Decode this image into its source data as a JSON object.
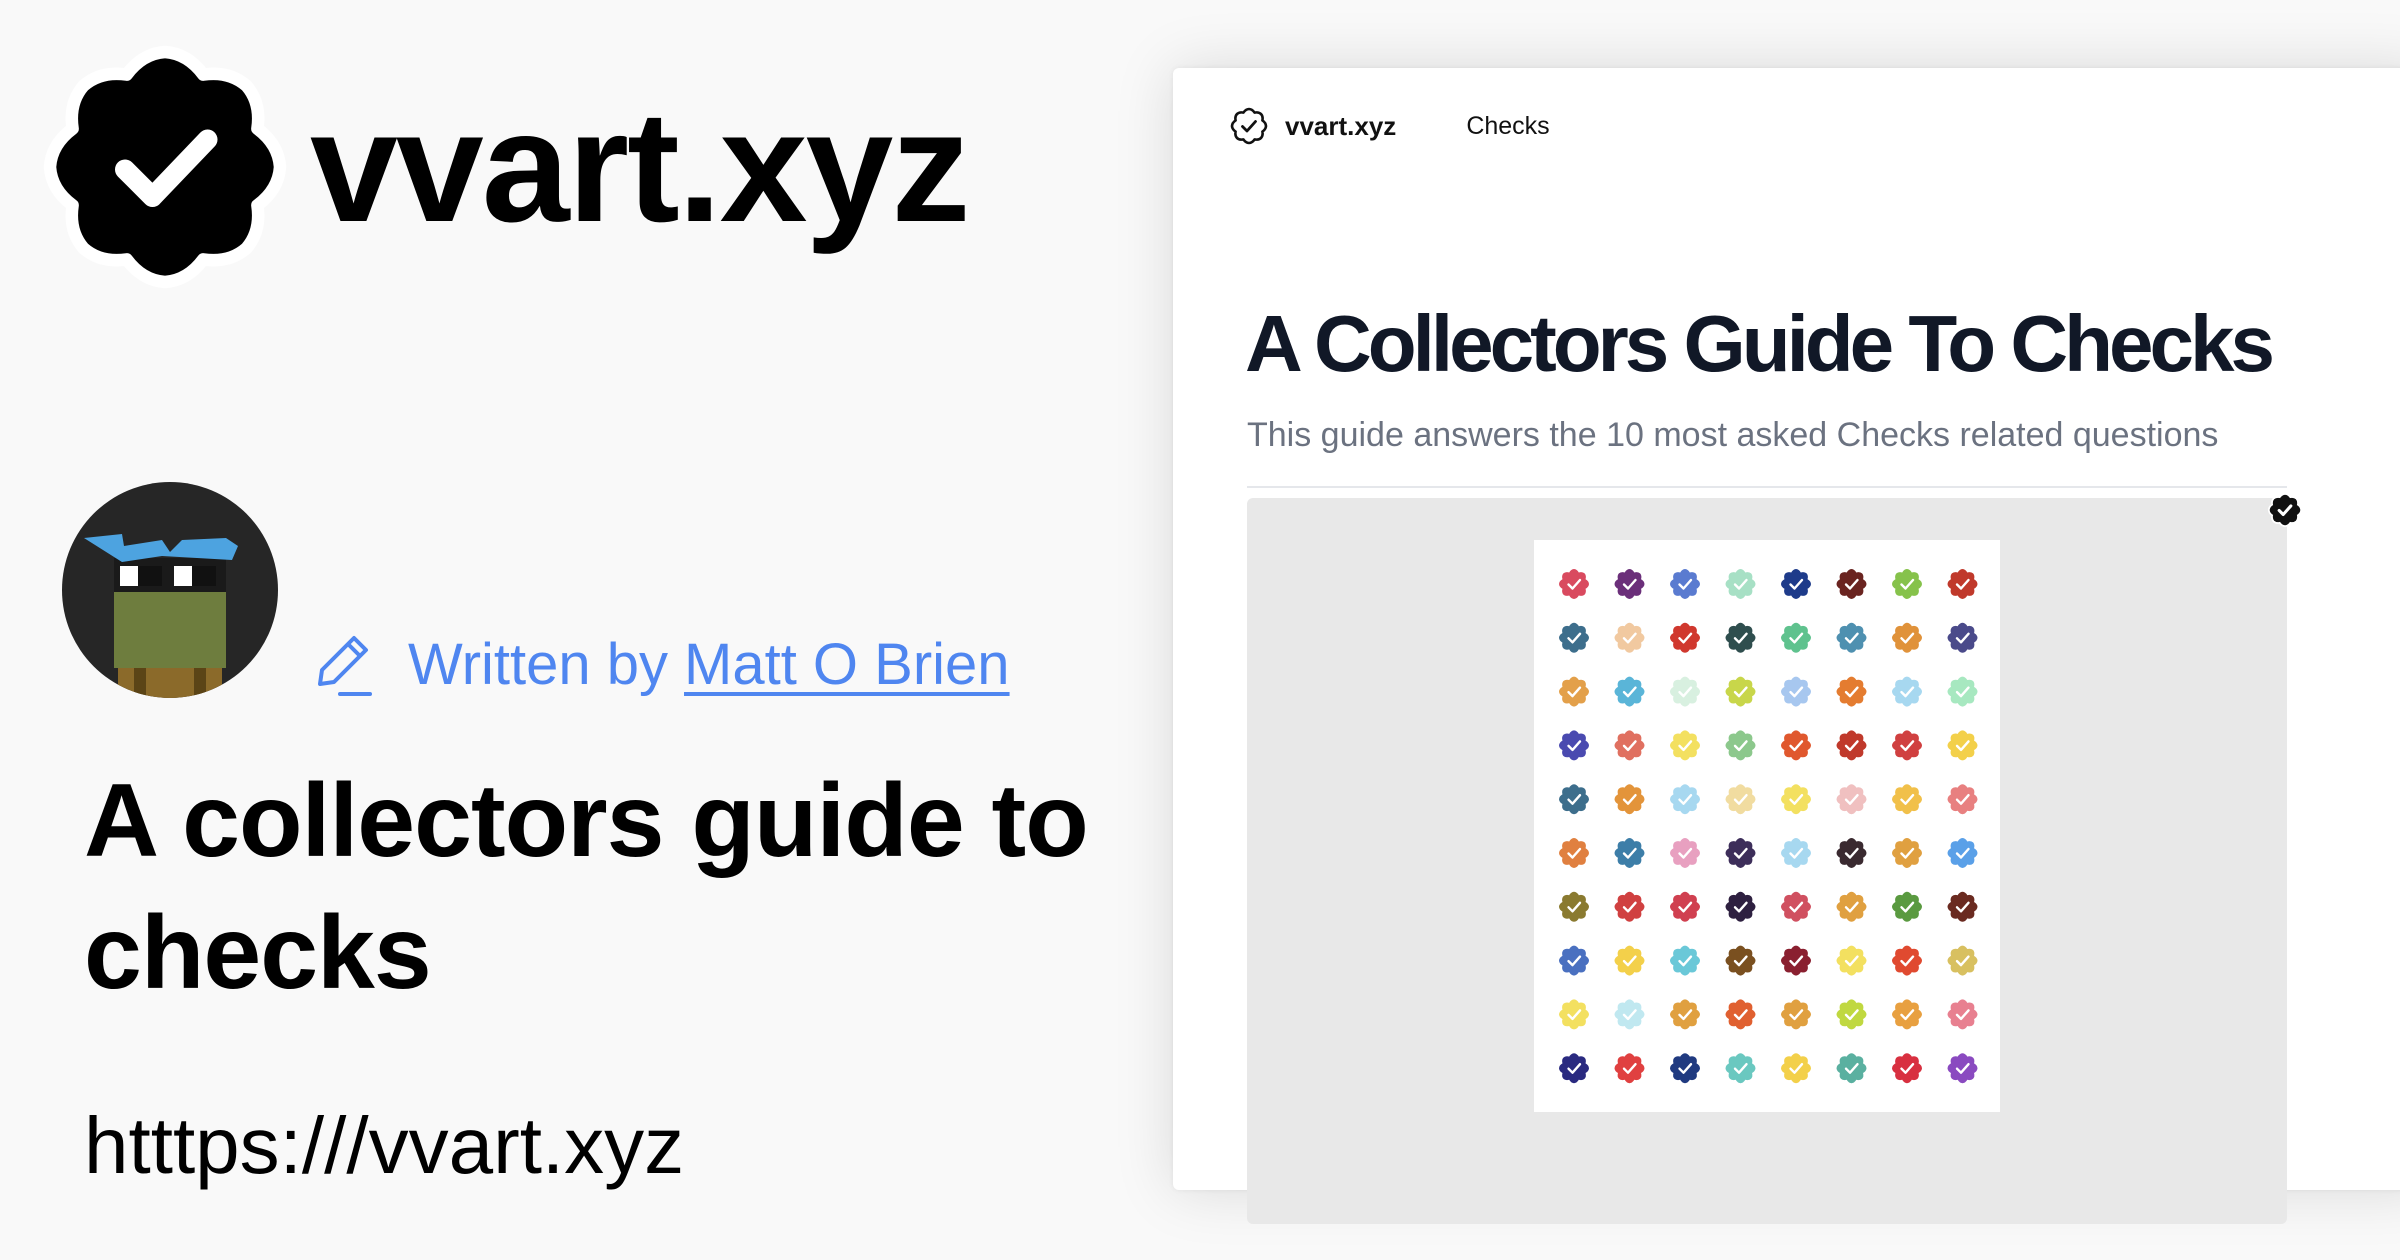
{
  "brand": {
    "name": "vvart.xyz",
    "badge_icon": "verified-check-badge"
  },
  "author": {
    "written_by": "Written by",
    "name": "Matt O Brien",
    "pencil_icon": "pencil-icon"
  },
  "hero": {
    "title": "A collectors guide to checks",
    "url": "htttps:///vvart.xyz"
  },
  "site": {
    "logo_name": "vvart.xyz",
    "nav_checks": "Checks",
    "title": "A Collectors Guide To Checks",
    "subtitle": "This guide answers the 10 most asked Checks related questions"
  },
  "checks_grid": {
    "columns": 8,
    "rows": 10,
    "colors": [
      [
        "#d94a5f",
        "#6b2f7a",
        "#5a7bd0",
        "#a7e0c5",
        "#1e3b8a",
        "#6a2420",
        "#86c24b",
        "#c0392b"
      ],
      [
        "#3d6e8c",
        "#f1c9a0",
        "#d0382e",
        "#2f4e4e",
        "#5fc28e",
        "#4e90b0",
        "#e0923a",
        "#4a4a8a"
      ],
      [
        "#e3a04a",
        "#5ab5d8",
        "#d8f0e0",
        "#c8d64a",
        "#a7c7ef",
        "#e47c30",
        "#a7d8f0",
        "#a7e8c0"
      ],
      [
        "#4a4ab0",
        "#e07060",
        "#f3e060",
        "#8cc88c",
        "#e0582e",
        "#c0392b",
        "#d04040",
        "#f3d04a"
      ],
      [
        "#3d6e8c",
        "#e3943a",
        "#a7d8f0",
        "#f1dca0",
        "#f3e060",
        "#f0c0c0",
        "#f1c04a",
        "#e88080"
      ],
      [
        "#e08040",
        "#3d7ea8",
        "#e8a0c0",
        "#3d2e5a",
        "#a7d8f0",
        "#3a2a30",
        "#e0a040",
        "#5aa0e8"
      ],
      [
        "#8a7a30",
        "#d04040",
        "#d04050",
        "#2e2040",
        "#d05060",
        "#e0a040",
        "#5a9a40",
        "#6a2a20"
      ],
      [
        "#4a70c0",
        "#f3d04a",
        "#6ac8d8",
        "#7a5020",
        "#8a2030",
        "#f3e060",
        "#e04a30",
        "#d8c060"
      ],
      [
        "#f3e060",
        "#c0e8f0",
        "#e0a040",
        "#e06030",
        "#e0a040",
        "#c0d840",
        "#e8a040",
        "#e88090"
      ],
      [
        "#2a2a80",
        "#e04040",
        "#203a80",
        "#6ac8c0",
        "#f3d04a",
        "#5ab0a0",
        "#d83040",
        "#8a4ac0"
      ]
    ]
  }
}
